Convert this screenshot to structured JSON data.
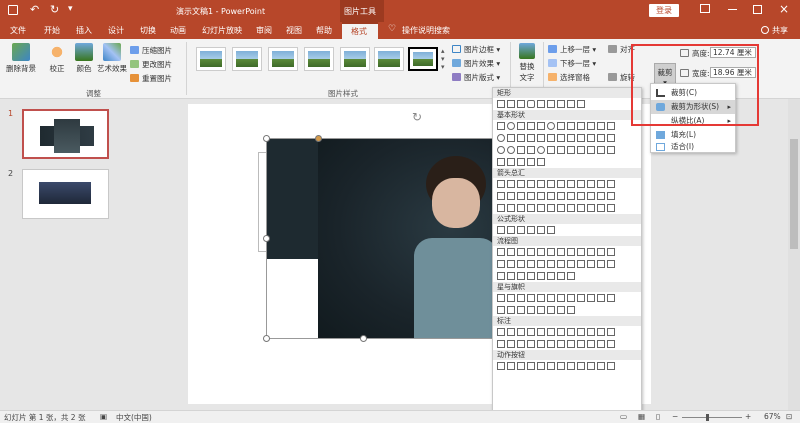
{
  "titlebar": {
    "title": "演示文稿1  -  PowerPoint",
    "context_label": "图片工具",
    "login_label": "登录",
    "share_label": "共享"
  },
  "tabs": [
    "文件",
    "开始",
    "插入",
    "设计",
    "切换",
    "动画",
    "幻灯片放映",
    "审阅",
    "视图",
    "帮助",
    "格式"
  ],
  "active_tab": "格式",
  "tell_me": "操作说明搜索",
  "ribbon": {
    "adjust": {
      "remove_bg": "删除背景",
      "correct": "校正",
      "color": "颜色",
      "artistic": "艺术效果",
      "compress": "压缩图片",
      "change": "更改图片",
      "reset": "重置图片",
      "label": "调整"
    },
    "styles": {
      "label": "图片样式",
      "border": "图片边框",
      "effects": "图片效果",
      "layout": "图片版式"
    },
    "alt_text": "替换\n文字",
    "arrange": {
      "bring_forward": "上移一层",
      "send_backward": "下移一层",
      "selection_pane": "选择窗格",
      "align": "对齐",
      "rotate": "旋转"
    },
    "size": {
      "crop": "裁剪",
      "height_label": "高度:",
      "height_value": "12.74 厘米",
      "width_label": "宽度:",
      "width_value": "18.96 厘米"
    }
  },
  "crop_menu": {
    "items": [
      "裁剪(C)",
      "裁剪为形状(S)",
      "纵横比(A)",
      "填充(L)",
      "适合(I)"
    ]
  },
  "shapes_gallery": {
    "sections": [
      "矩形",
      "基本形状",
      "箭头总汇",
      "公式形状",
      "流程图",
      "星与旗帜",
      "标注",
      "动作按钮"
    ]
  },
  "slides": [
    {
      "number": "1"
    },
    {
      "number": "2"
    }
  ],
  "statusbar": {
    "slide_info": "幻灯片 第 1 张，共 2 张",
    "language": "中文(中国)",
    "zoom": "67%"
  },
  "colors": {
    "accent": "#b7472a",
    "highlight": "#e53935"
  }
}
